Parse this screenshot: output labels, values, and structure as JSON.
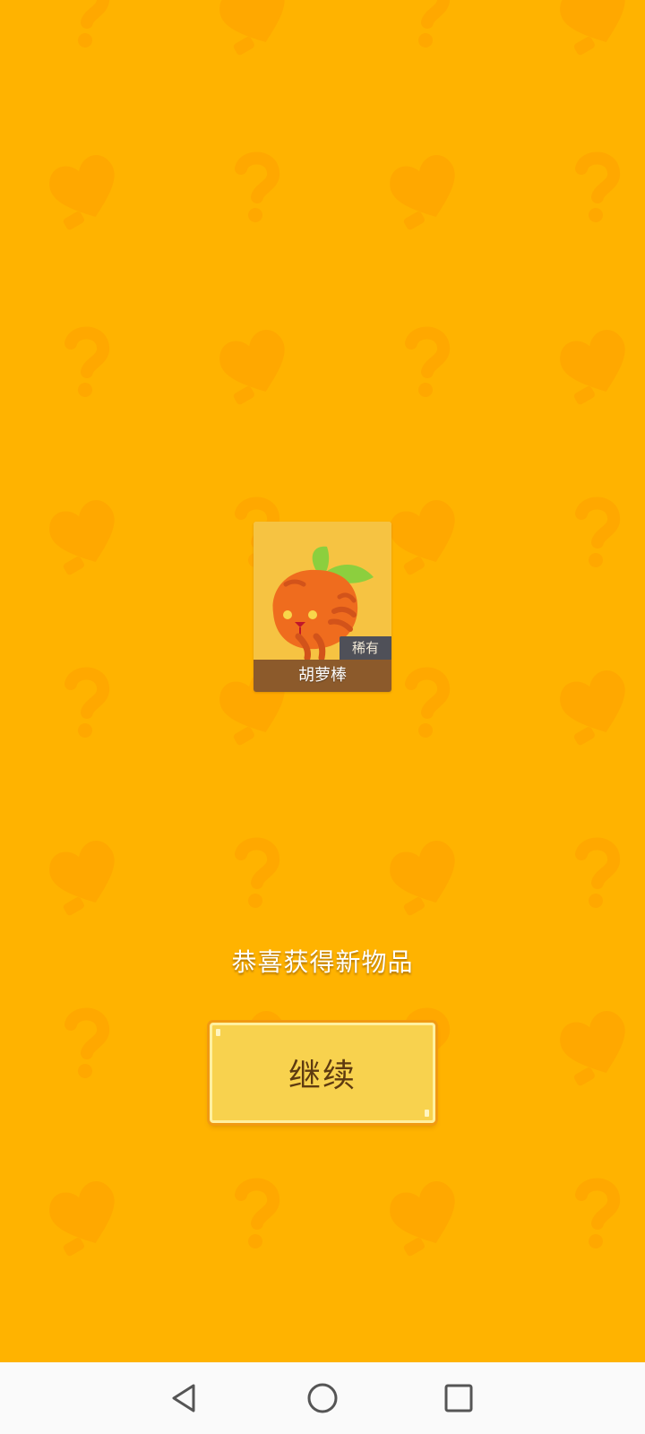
{
  "reward": {
    "item_name": "胡萝棒",
    "rarity": "稀有"
  },
  "congrats_text": "恭喜获得新物品",
  "continue_label": "继续",
  "colors": {
    "background": "#ffb300",
    "card": "#f6c342",
    "name_bar": "#8c5a2b",
    "button": "#f8d24e",
    "button_text": "#5e3a10"
  },
  "navigation": {
    "icons": [
      "back-icon",
      "home-icon",
      "recents-icon"
    ]
  }
}
